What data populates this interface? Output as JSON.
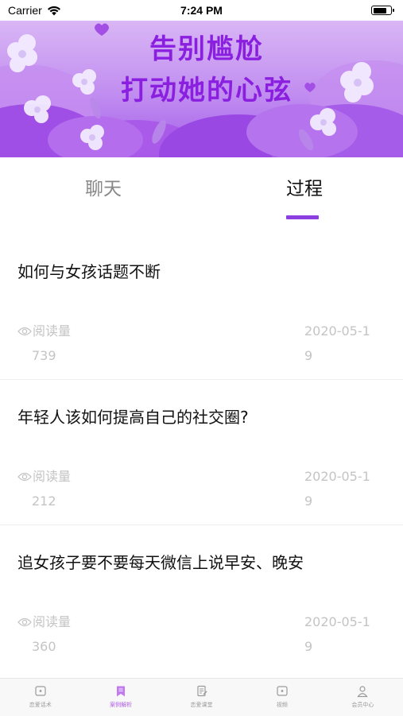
{
  "status_bar": {
    "carrier": "Carrier",
    "time": "7:24 PM"
  },
  "banner": {
    "line1": "告别尴尬",
    "line2": "打动她的心弦"
  },
  "tabs": [
    {
      "label": "聊天",
      "active": false
    },
    {
      "label": "过程",
      "active": true
    }
  ],
  "accent_color": "#8b3fe0",
  "articles": [
    {
      "title": "如何与女孩话题不断",
      "views_label": "阅读量",
      "views": "739",
      "date": "2020-05-19"
    },
    {
      "title": "年轻人该如何提高自己的社交圈?",
      "views_label": "阅读量",
      "views": "212",
      "date": "2020-05-19"
    },
    {
      "title": "追女孩子要不要每天微信上说早安、晚安",
      "views_label": "阅读量",
      "views": "360",
      "date": "2020-05-19"
    }
  ],
  "tabbar": [
    {
      "label": "恋爱话术",
      "icon": "chat-icon",
      "active": false
    },
    {
      "label": "案例解析",
      "icon": "bookmark-icon",
      "active": true
    },
    {
      "label": "恋爱课堂",
      "icon": "document-icon",
      "active": false
    },
    {
      "label": "视频",
      "icon": "video-icon",
      "active": false
    },
    {
      "label": "会员中心",
      "icon": "user-icon",
      "active": false
    }
  ]
}
